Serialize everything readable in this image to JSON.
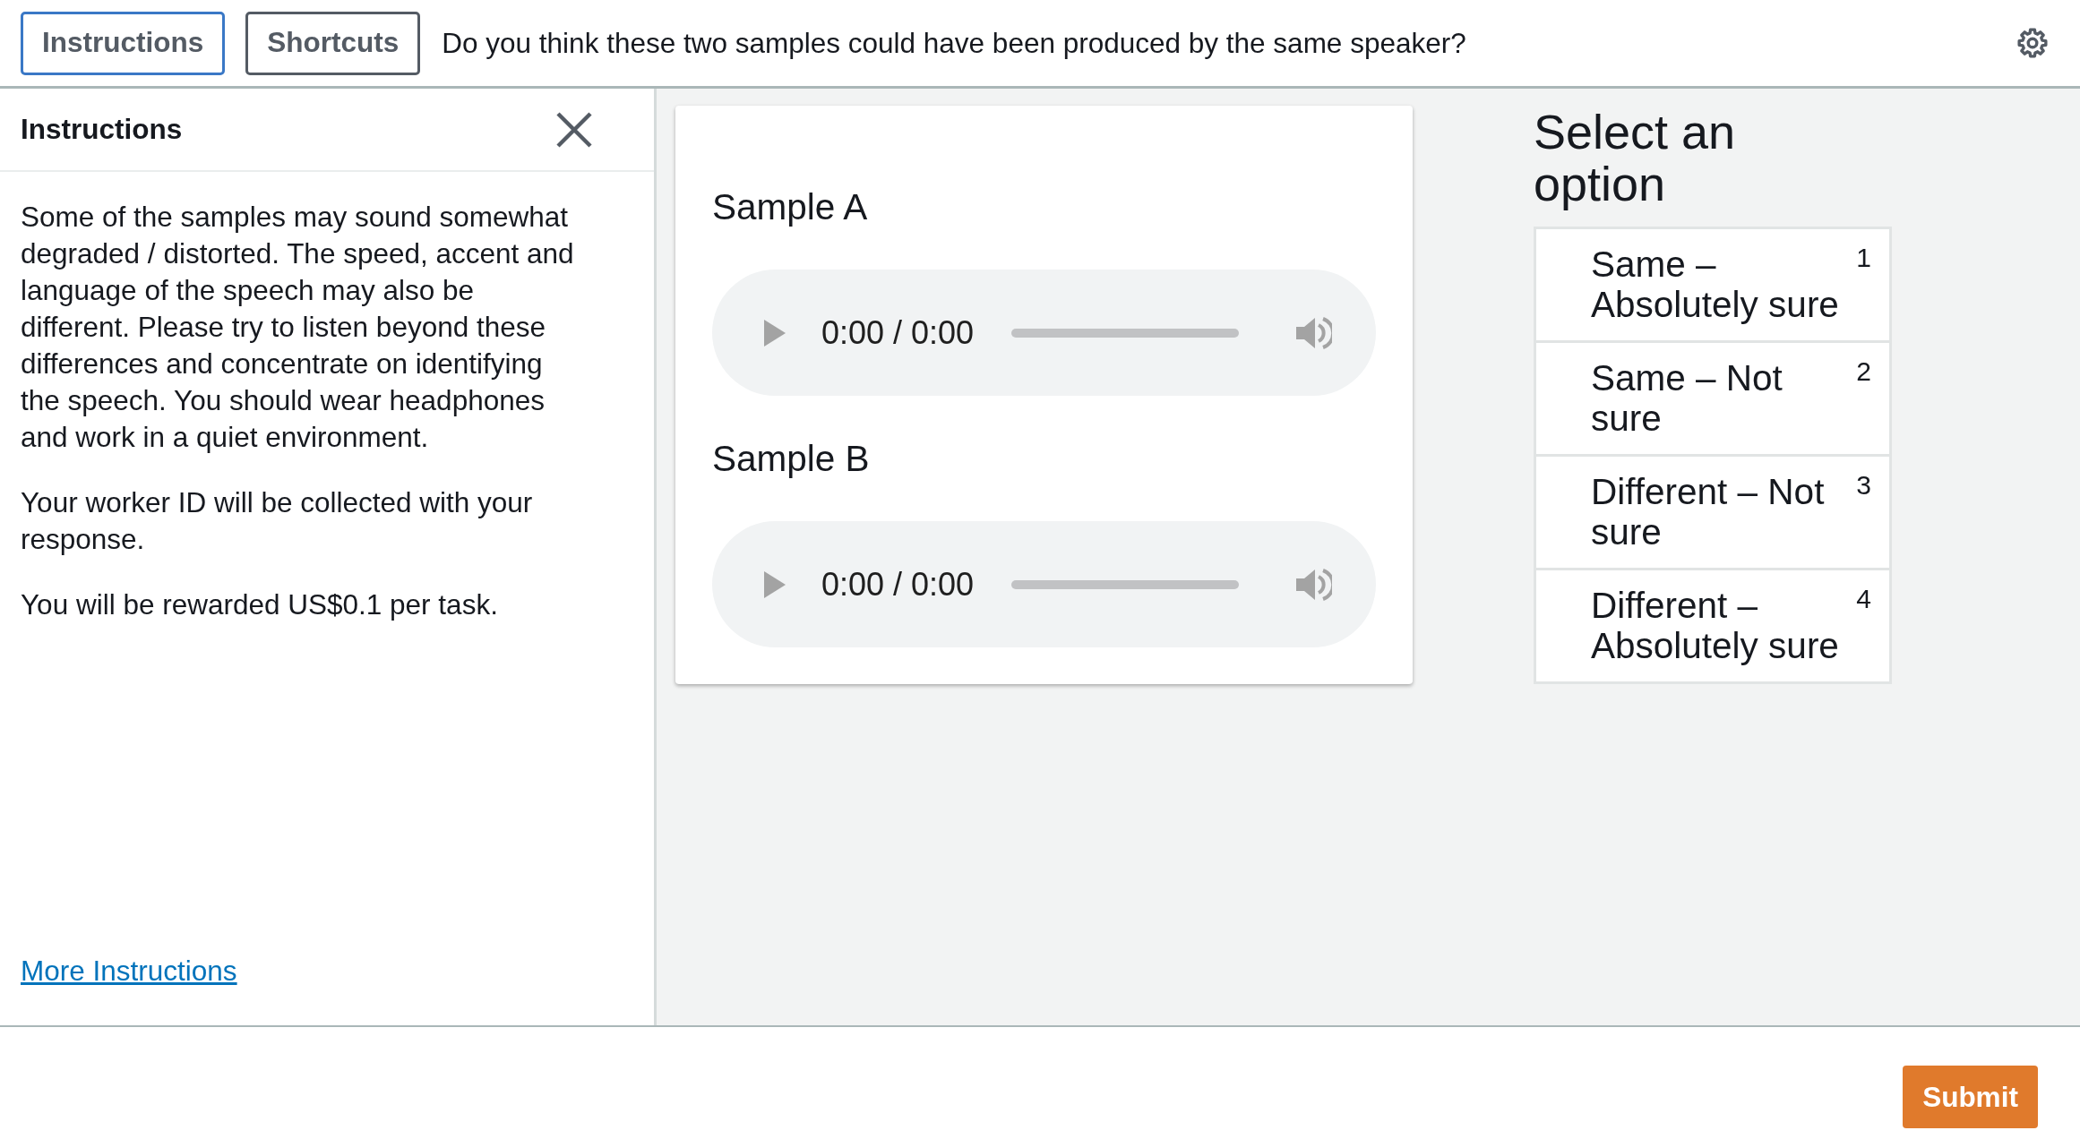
{
  "toolbar": {
    "tabs": [
      {
        "label": "Instructions",
        "selected": true
      },
      {
        "label": "Shortcuts",
        "selected": false
      }
    ],
    "question": "Do you think these two samples could have been produced by the same speaker?"
  },
  "instructions_panel": {
    "title": "Instructions",
    "paragraphs": [
      "Some of the samples may sound somewhat degraded / distorted. The speed, accent and language of the speech may also be different. Please try to listen beyond these differences and concentrate on identifying the speech. You should wear headphones and work in a quiet environment.",
      "Your worker ID will be collected with your response.",
      "You will be rewarded US$0.1 per task."
    ],
    "link": "More Instructions"
  },
  "samples": [
    {
      "title": "Sample A",
      "time": "0:00 / 0:00",
      "level": 0
    },
    {
      "title": "Sample B",
      "time": "0:00 / 0:00",
      "level": 0
    }
  ],
  "options_panel": {
    "title": "Select an option",
    "options": [
      {
        "label": "Same – Absolutely sure",
        "shortcut": "1",
        "selected": false
      },
      {
        "label": "Same – Not sure",
        "shortcut": "2",
        "selected": false
      },
      {
        "label": "Different – Not sure",
        "shortcut": "3",
        "selected": false
      },
      {
        "label": "Different – Absolutely sure",
        "shortcut": "4",
        "selected": false
      }
    ]
  },
  "submit_button": "Submit"
}
